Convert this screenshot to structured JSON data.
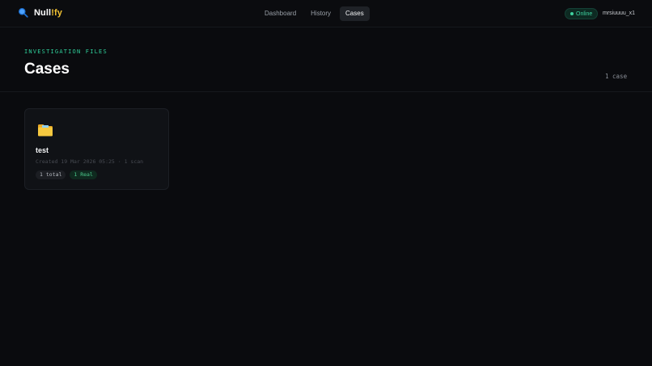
{
  "brand": {
    "name_prefix": "Null",
    "name_accent": "!fy",
    "icon": "search-icon"
  },
  "nav": {
    "items": [
      {
        "label": "Dashboard",
        "active": false
      },
      {
        "label": "History",
        "active": false
      },
      {
        "label": "Cases",
        "active": true
      }
    ]
  },
  "status": {
    "online_label": "Online",
    "username": "mrsiuuuu_x1"
  },
  "header": {
    "eyebrow": "INVESTIGATION FILES",
    "title": "Cases",
    "count": "1 case"
  },
  "cases": [
    {
      "icon": "folder-icon",
      "name": "test",
      "meta": "Created 19 Mar 2026 05:25 · 1 scan",
      "tags": {
        "total": "1 total",
        "real": "1 Real"
      }
    }
  ],
  "colors": {
    "background": "#0a0b0e",
    "accent_green": "#2fcf9a",
    "brand_accent": "#f2c232",
    "card_bg": "#101216"
  }
}
